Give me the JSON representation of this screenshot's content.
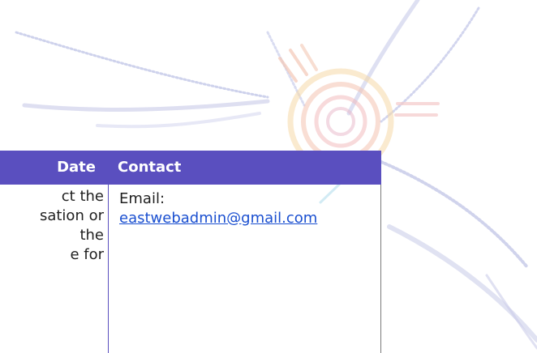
{
  "table": {
    "headers": {
      "date": "Date",
      "contact": "Contact"
    },
    "row": {
      "description_lines": [
        "ct the",
        "sation or",
        "the",
        "e for",
        "."
      ],
      "contact_label": "Email:",
      "contact_email": "eastwebadmin@gmail.com"
    }
  },
  "colors": {
    "header_bg": "#5a4fbf",
    "header_text": "#ffffff",
    "link": "#1a4fd0",
    "body_text": "#1f1f1f"
  }
}
